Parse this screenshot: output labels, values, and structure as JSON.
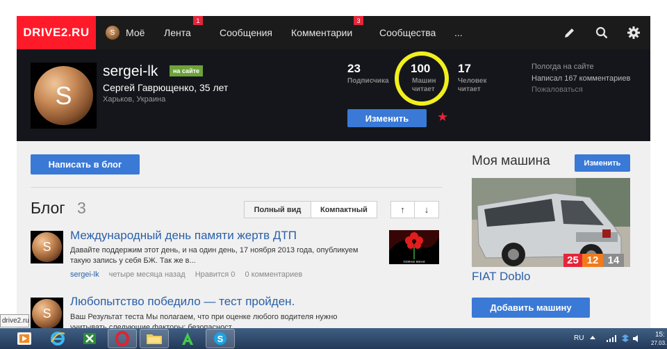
{
  "logo": "DRIVE2.RU",
  "nav": {
    "my_initial": "S",
    "my": "Моё",
    "feed": "Лента",
    "feed_badge": "1",
    "messages": "Сообщения",
    "comments": "Комментарии",
    "comments_badge": "3",
    "communities": "Сообщества",
    "more": "...",
    "icons": [
      "pencil-icon",
      "search-icon",
      "gear-icon"
    ]
  },
  "profile": {
    "avatar_letter": "S",
    "username": "sergei-lk",
    "online_badge": "на сайте",
    "fullname": "Сергей Гаврющенко, 35 лет",
    "city": "Харьков, Украина",
    "stats": [
      {
        "value": "23",
        "label_1": "Подписчика",
        "label_2": ""
      },
      {
        "value": "100",
        "label_1": "Машин",
        "label_2": "читает"
      },
      {
        "value": "17",
        "label_1": "Человек",
        "label_2": "читает"
      }
    ],
    "edit_button": "Изменить",
    "side_info": {
      "weather": "Пологда на сайте",
      "comments": "Написал 167 комментариев",
      "complain": "Пожаловаться"
    }
  },
  "main": {
    "write_blog_button": "Написать в блог",
    "blog_title": "Блог",
    "blog_count": "3",
    "view_full": "Полный вид",
    "view_compact": "Компактный",
    "sort_up": "↑",
    "sort_down": "↓",
    "posts": [
      {
        "avatar_letter": "S",
        "title": "Международный день памяти жертв ДТП",
        "text": "Давайте поддержим этот день, и на один день, 17 ноября 2013 года, опубликуем такую запись у себя БЖ. Так же в...",
        "author": "sergei-lk",
        "time": "четыре месяца назад",
        "likes": "Нравится 0",
        "comments": "0 комментариев",
        "thumb_caption": "помни меня"
      },
      {
        "avatar_letter": "S",
        "title": "Любопытство победило — тест пройден.",
        "text": "Ваш Результат теста Мы полагаем, что при оценке любого водителя нужно учитывать следующие факторы: безопасност..."
      }
    ]
  },
  "car": {
    "heading": "Моя машина",
    "edit_button": "Изменить",
    "ratings": [
      {
        "value": "25",
        "color": "#e5253a"
      },
      {
        "value": "12",
        "color": "#f07b1d"
      },
      {
        "value": "14",
        "color": "#8c8c8c"
      }
    ],
    "name": "FIAT Doblo",
    "add_button": "Добавить машину"
  },
  "taskbar": {
    "tooltip": "drive2.ru",
    "lang": "RU",
    "clock_time": "15:",
    "clock_date": "27.03."
  }
}
